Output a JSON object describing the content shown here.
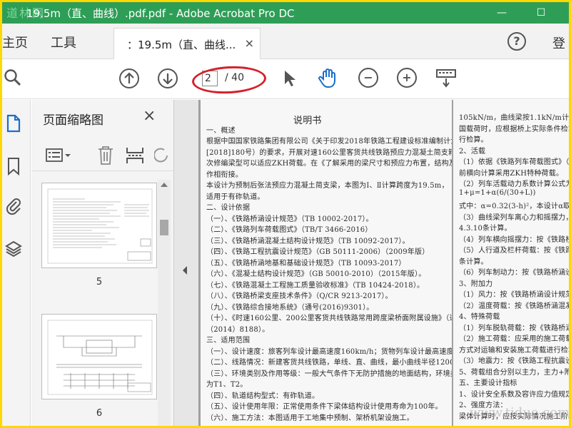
{
  "window": {
    "title": "19.5m（直、曲线）.pdf.pdf - Adobe Acrobat Pro DC",
    "watermark_logo": "道林网",
    "min_glyph": "—",
    "max_glyph": "☐"
  },
  "tabs": {
    "home": "主页",
    "tools": "工具",
    "document_tab": "：19.5m（直、曲线...",
    "close_glyph": "×",
    "help_glyph": "?",
    "signin": "登"
  },
  "toolbar": {
    "current_page": "2",
    "total_pages": "/ 40",
    "zoom_out_glyph": "−",
    "zoom_in_glyph": "+",
    "highlight_color": "#d6202a"
  },
  "thumbnails": {
    "title": "页面缩略图",
    "close_glyph": "×",
    "pages": [
      {
        "number": "5"
      },
      {
        "number": "6"
      }
    ]
  },
  "document": {
    "page_main": [
      {
        "text": "说明书",
        "cls": "h"
      },
      {
        "text": "一、概述"
      },
      {
        "text": "根据中国国家铁路集团有限公司《关于印发2018年铁路工程建设标准编制计划的通知》（铁总建设"
      },
      {
        "text": "[2018]180号）的要求，开展对速160公里客货共线铁路预应力混凝土简支箱梁通用图的修订编制工作。本"
      },
      {
        "text": "次修编梁型可以适应ZKH荷载。在《了解采用的梁尺寸和预应力布置，结构及附属构造通过全线的规划与关"
      },
      {
        "text": "作相衔接。"
      },
      {
        "text": "本设计为预制后张法预应力混凝土简支梁，本图为Ⅰ、Ⅱ计算跨度为19.5m，"
      },
      {
        "text": "适用于有砟轨道。"
      },
      {
        "text": "二、设计依据"
      },
      {
        "text": "（一）、《铁路桥涵设计规范》（TB 10002-2017）。"
      },
      {
        "text": "（二）、《铁路列车荷载图式》（TB/T 3466-2016）"
      },
      {
        "text": "（三）、《铁路桥涵混凝土结构设计规范》（TB 10092-2017）。"
      },
      {
        "text": "（四）、《铁路工程抗震设计规范》（GB 50111-2006）（2009年版）"
      },
      {
        "text": "（五）、《铁路桥涵地基和基础设计规范》（TB 10093-2017）"
      },
      {
        "text": "（六）、《混凝土结构设计规范》（GB 50010-2010）（2015年版）。"
      },
      {
        "text": "（七）、《铁路混凝土工程施工质量验收标准》（TB 10424-2018）。"
      },
      {
        "text": "（八）、《铁路桥梁支座技术条件》（Q/CR 9213-2017）。"
      },
      {
        "text": "（九）、《铁路综合接地系统》（通号(2016)9301）。"
      },
      {
        "text": "（十）、《时速160公里、200公里客货共线铁路常用跨度梁桥面附属设施》（通桥"
      },
      {
        "text": "（2014）8188）。"
      },
      {
        "text": "三、适用范围"
      },
      {
        "text": "（一）、设计速度：旅客列车设计最高速度160km/h；货物列车设计最高速度120km/h。"
      },
      {
        "text": "（二）、线路情况：新建客货共线铁路，单线、直、曲线，最小曲线半径1200m。"
      },
      {
        "text": "（三）、环境类别及作用等级：一般大气条件下无防护措施的地面结构，环境类别为碳化环境，作用等级"
      },
      {
        "text": "为T1、T2。"
      },
      {
        "text": "（四）、轨道结构型式：有砟轨道。"
      },
      {
        "text": "（五）、设计使用年限：正常使用条件下梁体结构设计使用寿命为100年。"
      },
      {
        "text": "（六）、施工方法：本图适用于工地集中预制、架桥机架设施工。"
      }
    ],
    "page_right": [
      {
        "text": "105kN/m，曲线梁按1.1kN/m计算；无声屏障直"
      },
      {
        "text": "国载荷时，应根据桥上实际条件检算相应荷"
      },
      {
        "text": "行检算。"
      },
      {
        "text": "2、活载"
      },
      {
        "text": "（1）依据《铁路列车荷载图式》（TB/T 3466"
      },
      {
        "text": "前横向计算采用ZKH特种荷载。"
      },
      {
        "text": "（2）列车活载动力系数计算公式为："
      },
      {
        "text": "1+μ=1+α(6/(30+L))"
      },
      {
        "text": "式中：α=0.32(3-h)²，本设计α取2，"
      },
      {
        "text": "（3）曲线梁列车离心力和摇摆力，按"
      },
      {
        "text": "4.3.10条计算。"
      },
      {
        "text": "（4）列车横向摇摆力：按《铁路桥涵设计规范》"
      },
      {
        "text": "（5）人行道及栏杆荷载：按《铁路桥涵设计规范》"
      },
      {
        "text": "条计算。"
      },
      {
        "text": "（6）列车制动力：按《铁路桥涵设计规范》"
      },
      {
        "text": "3、附加力"
      },
      {
        "text": "（1）风力：按《铁路桥涵设计规范》（TB10"
      },
      {
        "text": "（2）温度荷载：按《铁路桥涵混凝土结构设计规范"
      },
      {
        "text": "4、特殊荷载"
      },
      {
        "text": "（1）列车脱轨荷载：按《铁路桥涵设计规范》"
      },
      {
        "text": "（2）施工荷载：应采用的施工荷载大于设计"
      },
      {
        "text": "方式对运输和安装施工荷载进行检算。"
      },
      {
        "text": "（3）地震力：按《铁路工程抗震设计规范》"
      },
      {
        "text": "5、荷载组合分别以主力，主力+附加力组合"
      },
      {
        "text": "五、主要设计指标"
      },
      {
        "text": "1、设计安全系数及容许应力值规定见表："
      },
      {
        "text": "2、强度方法："
      },
      {
        "text": "梁体计算时，应按实际情况施工阶段计算。"
      }
    ],
    "bottom_watermark": "www.tiduo.com"
  }
}
